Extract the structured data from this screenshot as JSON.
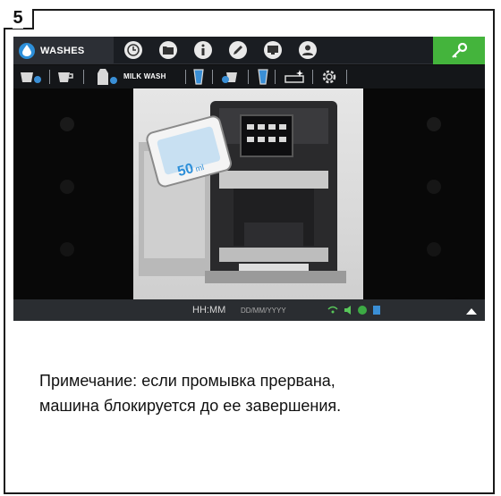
{
  "step": {
    "number": "5"
  },
  "screen": {
    "topbar": {
      "washes_label": "WASHES",
      "icons": [
        "clock-icon",
        "folder-icon",
        "info-icon",
        "pencil-icon",
        "display-icon",
        "user-icon"
      ],
      "key_icon": "key-icon"
    },
    "subbar": {
      "milk_wash_label": "MILK WASH",
      "icons": [
        "cup-rinse-icon",
        "cup-icon",
        "milk-carton-icon",
        "glass-icon",
        "cup-hand-icon",
        "glass-icon",
        "tray-clean-icon",
        "gear-icon"
      ]
    },
    "photo": {
      "dose_label": "50",
      "dose_unit": "ml"
    },
    "status": {
      "time": "HH:MM",
      "date": "DD/MM/YYYY"
    },
    "confirm_icon": "check-icon"
  },
  "note": {
    "text": "Примечание: если промывка прервана, машина блокируется до ее завершения."
  },
  "colors": {
    "accent_green": "#44b43c",
    "washes_blue": "#2d8fd9"
  }
}
